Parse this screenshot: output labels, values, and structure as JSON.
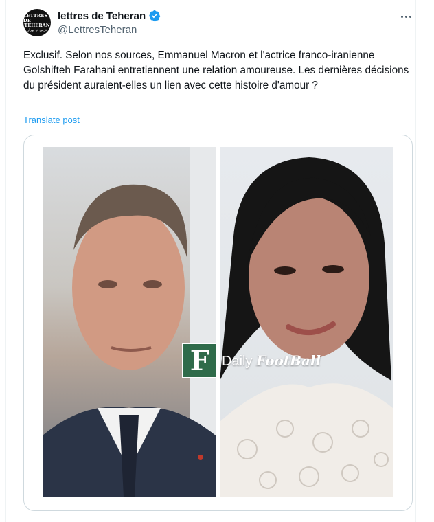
{
  "author": {
    "avatar_text": [
      "LETTRES DE",
      "TEHERAN",
      "لترس دو تهران"
    ],
    "display_name": "lettres de Teheran",
    "handle": "@LettresTeheran",
    "verified": true,
    "verified_color": "#1d9bf0"
  },
  "post": {
    "text": "Exclusif. Selon nos sources, Emmanuel Macron et l'actrice franco-iranienne Golshifteh Farahani entretiennent une relation amoureuse. Les dernières décisions du président auraient-elles un lien avec cette histoire d'amour ?",
    "translate_label": "Translate post"
  },
  "media": {
    "watermark_logo": "F",
    "watermark_word1": "Daily",
    "watermark_word2": "FootBall",
    "watermark_color": "#2f6b4a"
  },
  "icons": {
    "more": "more-horizontal-icon",
    "verified": "verified-badge-icon"
  },
  "colors": {
    "text_primary": "#0f1419",
    "text_secondary": "#536471",
    "link": "#1d9bf0",
    "border": "#cfd9de"
  }
}
